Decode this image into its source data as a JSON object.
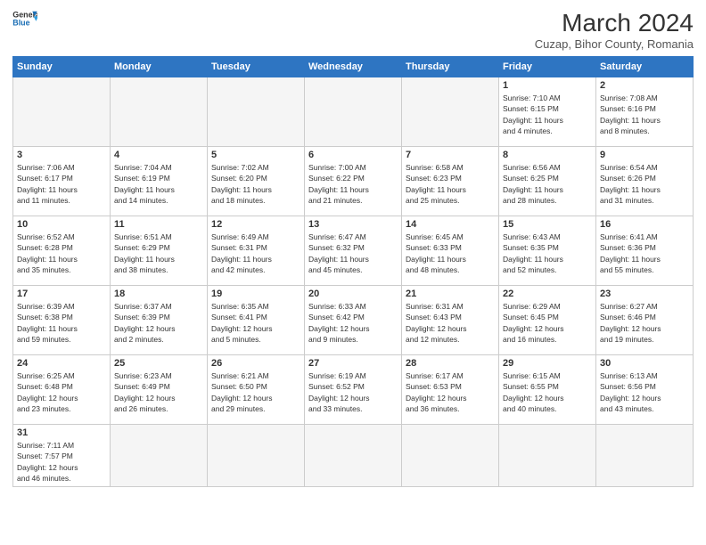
{
  "logo": {
    "line1": "General",
    "line2": "Blue"
  },
  "title": "March 2024",
  "subtitle": "Cuzap, Bihor County, Romania",
  "weekdays": [
    "Sunday",
    "Monday",
    "Tuesday",
    "Wednesday",
    "Thursday",
    "Friday",
    "Saturday"
  ],
  "weeks": [
    [
      {
        "day": "",
        "info": ""
      },
      {
        "day": "",
        "info": ""
      },
      {
        "day": "",
        "info": ""
      },
      {
        "day": "",
        "info": ""
      },
      {
        "day": "",
        "info": ""
      },
      {
        "day": "1",
        "info": "Sunrise: 7:10 AM\nSunset: 6:15 PM\nDaylight: 11 hours\nand 4 minutes."
      },
      {
        "day": "2",
        "info": "Sunrise: 7:08 AM\nSunset: 6:16 PM\nDaylight: 11 hours\nand 8 minutes."
      }
    ],
    [
      {
        "day": "3",
        "info": "Sunrise: 7:06 AM\nSunset: 6:17 PM\nDaylight: 11 hours\nand 11 minutes."
      },
      {
        "day": "4",
        "info": "Sunrise: 7:04 AM\nSunset: 6:19 PM\nDaylight: 11 hours\nand 14 minutes."
      },
      {
        "day": "5",
        "info": "Sunrise: 7:02 AM\nSunset: 6:20 PM\nDaylight: 11 hours\nand 18 minutes."
      },
      {
        "day": "6",
        "info": "Sunrise: 7:00 AM\nSunset: 6:22 PM\nDaylight: 11 hours\nand 21 minutes."
      },
      {
        "day": "7",
        "info": "Sunrise: 6:58 AM\nSunset: 6:23 PM\nDaylight: 11 hours\nand 25 minutes."
      },
      {
        "day": "8",
        "info": "Sunrise: 6:56 AM\nSunset: 6:25 PM\nDaylight: 11 hours\nand 28 minutes."
      },
      {
        "day": "9",
        "info": "Sunrise: 6:54 AM\nSunset: 6:26 PM\nDaylight: 11 hours\nand 31 minutes."
      }
    ],
    [
      {
        "day": "10",
        "info": "Sunrise: 6:52 AM\nSunset: 6:28 PM\nDaylight: 11 hours\nand 35 minutes."
      },
      {
        "day": "11",
        "info": "Sunrise: 6:51 AM\nSunset: 6:29 PM\nDaylight: 11 hours\nand 38 minutes."
      },
      {
        "day": "12",
        "info": "Sunrise: 6:49 AM\nSunset: 6:31 PM\nDaylight: 11 hours\nand 42 minutes."
      },
      {
        "day": "13",
        "info": "Sunrise: 6:47 AM\nSunset: 6:32 PM\nDaylight: 11 hours\nand 45 minutes."
      },
      {
        "day": "14",
        "info": "Sunrise: 6:45 AM\nSunset: 6:33 PM\nDaylight: 11 hours\nand 48 minutes."
      },
      {
        "day": "15",
        "info": "Sunrise: 6:43 AM\nSunset: 6:35 PM\nDaylight: 11 hours\nand 52 minutes."
      },
      {
        "day": "16",
        "info": "Sunrise: 6:41 AM\nSunset: 6:36 PM\nDaylight: 11 hours\nand 55 minutes."
      }
    ],
    [
      {
        "day": "17",
        "info": "Sunrise: 6:39 AM\nSunset: 6:38 PM\nDaylight: 11 hours\nand 59 minutes."
      },
      {
        "day": "18",
        "info": "Sunrise: 6:37 AM\nSunset: 6:39 PM\nDaylight: 12 hours\nand 2 minutes."
      },
      {
        "day": "19",
        "info": "Sunrise: 6:35 AM\nSunset: 6:41 PM\nDaylight: 12 hours\nand 5 minutes."
      },
      {
        "day": "20",
        "info": "Sunrise: 6:33 AM\nSunset: 6:42 PM\nDaylight: 12 hours\nand 9 minutes."
      },
      {
        "day": "21",
        "info": "Sunrise: 6:31 AM\nSunset: 6:43 PM\nDaylight: 12 hours\nand 12 minutes."
      },
      {
        "day": "22",
        "info": "Sunrise: 6:29 AM\nSunset: 6:45 PM\nDaylight: 12 hours\nand 16 minutes."
      },
      {
        "day": "23",
        "info": "Sunrise: 6:27 AM\nSunset: 6:46 PM\nDaylight: 12 hours\nand 19 minutes."
      }
    ],
    [
      {
        "day": "24",
        "info": "Sunrise: 6:25 AM\nSunset: 6:48 PM\nDaylight: 12 hours\nand 23 minutes."
      },
      {
        "day": "25",
        "info": "Sunrise: 6:23 AM\nSunset: 6:49 PM\nDaylight: 12 hours\nand 26 minutes."
      },
      {
        "day": "26",
        "info": "Sunrise: 6:21 AM\nSunset: 6:50 PM\nDaylight: 12 hours\nand 29 minutes."
      },
      {
        "day": "27",
        "info": "Sunrise: 6:19 AM\nSunset: 6:52 PM\nDaylight: 12 hours\nand 33 minutes."
      },
      {
        "day": "28",
        "info": "Sunrise: 6:17 AM\nSunset: 6:53 PM\nDaylight: 12 hours\nand 36 minutes."
      },
      {
        "day": "29",
        "info": "Sunrise: 6:15 AM\nSunset: 6:55 PM\nDaylight: 12 hours\nand 40 minutes."
      },
      {
        "day": "30",
        "info": "Sunrise: 6:13 AM\nSunset: 6:56 PM\nDaylight: 12 hours\nand 43 minutes."
      }
    ],
    [
      {
        "day": "31",
        "info": "Sunrise: 7:11 AM\nSunset: 7:57 PM\nDaylight: 12 hours\nand 46 minutes."
      },
      {
        "day": "",
        "info": ""
      },
      {
        "day": "",
        "info": ""
      },
      {
        "day": "",
        "info": ""
      },
      {
        "day": "",
        "info": ""
      },
      {
        "day": "",
        "info": ""
      },
      {
        "day": "",
        "info": ""
      }
    ]
  ]
}
